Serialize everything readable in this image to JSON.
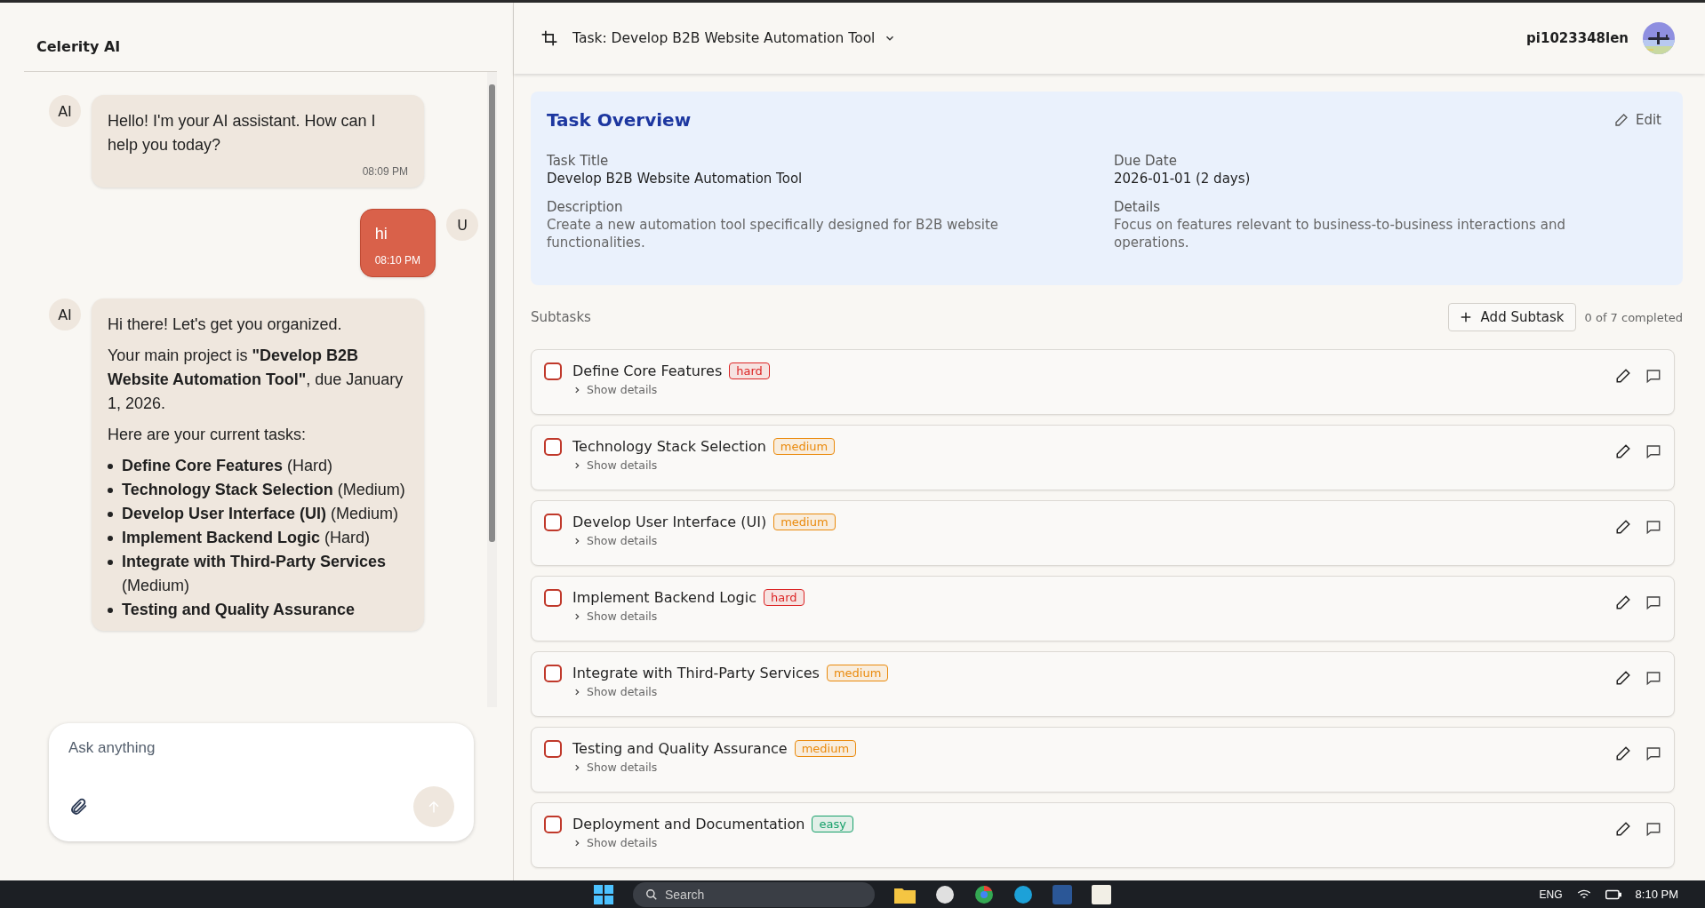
{
  "chat": {
    "title": "Celerity AI",
    "messages": [
      {
        "kind": "assistant",
        "avatar": "AI",
        "paragraphs": [
          "Hello! I'm your AI assistant. How can I help you today?"
        ],
        "time": "08:09 PM"
      },
      {
        "kind": "user",
        "avatar": "U",
        "paragraphs": [
          "hi"
        ],
        "time": "08:10 PM"
      },
      {
        "kind": "assistant",
        "avatar": "AI",
        "paragraphs": [
          "Hi there! Let's get you organized.",
          "Your main project is **\"Develop B2B Website Automation Tool\"**, due January 1, 2026.",
          "Here are your current tasks:"
        ],
        "list": [
          {
            "name": "Define Core Features",
            "note": "(Hard)"
          },
          {
            "name": "Technology Stack Selection",
            "note": "(Medium)"
          },
          {
            "name": "Develop User Interface (UI)",
            "note": "(Medium)"
          },
          {
            "name": "Implement Backend Logic",
            "note": "(Hard)"
          },
          {
            "name": "Integrate with Third-Party Services",
            "note": "(Medium)"
          },
          {
            "name": "Testing and Quality Assurance"
          }
        ]
      }
    ],
    "input": {
      "placeholder": "Ask anything"
    }
  },
  "header": {
    "title": "Task: Develop B2B Website Automation Tool",
    "user": "pi1023348len"
  },
  "overview": {
    "title": "Task Overview",
    "edit": "Edit",
    "fields": [
      {
        "label": "Task Title",
        "value": "Develop B2B Website Automation Tool",
        "kind": "strong"
      },
      {
        "label": "Due Date",
        "value": "2026-01-01 (2 days)",
        "kind": "strong"
      },
      {
        "label": "Description",
        "value": "Create a new automation tool specifically designed for B2B website functionalities.",
        "kind": "muted"
      },
      {
        "label": "Details",
        "value": "Focus on features relevant to business-to-business interactions and operations.",
        "kind": "muted"
      }
    ]
  },
  "subtasks": {
    "label": "Subtasks",
    "add": "Add Subtask",
    "progress": "0 of 7 completed",
    "items": [
      {
        "title": "Define Core Features",
        "tag": "hard",
        "color": "#dc2626",
        "checked": false,
        "toggle": "Show details"
      },
      {
        "title": "Technology Stack Selection",
        "tag": "medium",
        "color": "#ea8a0c",
        "checked": false,
        "toggle": "Show details"
      },
      {
        "title": "Develop User Interface (UI)",
        "tag": "medium",
        "color": "#ea8a0c",
        "checked": false,
        "toggle": "Show details"
      },
      {
        "title": "Implement Backend Logic",
        "tag": "hard",
        "color": "#dc2626",
        "checked": false,
        "toggle": "Show details"
      },
      {
        "title": "Integrate with Third-Party Services",
        "tag": "medium",
        "color": "#ea8a0c",
        "checked": false,
        "toggle": "Show details"
      },
      {
        "title": "Testing and Quality Assurance",
        "tag": "medium",
        "color": "#ea8a0c",
        "checked": false,
        "toggle": "Show details"
      },
      {
        "title": "Deployment and Documentation",
        "tag": "easy",
        "color": "#16a06a",
        "checked": false,
        "toggle": "Show details"
      }
    ]
  },
  "taskbar": {
    "search": "Search",
    "language": "ENG",
    "time": "8:10 PM"
  }
}
